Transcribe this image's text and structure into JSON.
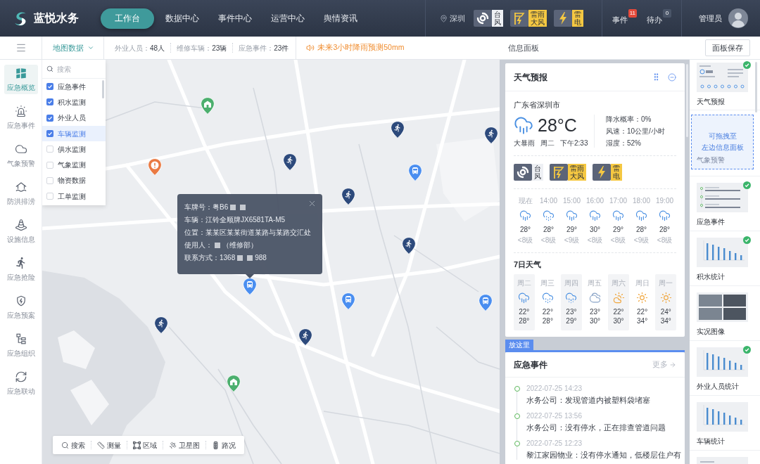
{
  "header": {
    "brand": "蓝悦水务",
    "nav": [
      {
        "label": "工作台",
        "selected": true
      },
      {
        "label": "数据中心",
        "selected": false
      },
      {
        "label": "事件中心",
        "selected": false
      },
      {
        "label": "运营中心",
        "selected": false
      },
      {
        "label": "舆情资讯",
        "selected": false
      }
    ],
    "location": "深圳",
    "warnings": [
      {
        "kind": "typhoon",
        "label": "台风",
        "color": "#eef0f4"
      },
      {
        "kind": "thunderstorm_wind",
        "label": "雷雨大风",
        "color": "#f5c842"
      },
      {
        "kind": "lightning",
        "label": "雷电",
        "color": "#f5c842"
      }
    ],
    "notifications": [
      {
        "label": "事件",
        "count": "11",
        "color": "#e5493a"
      },
      {
        "label": "待办",
        "count": "0",
        "color": "#4a5568"
      }
    ],
    "user": "管理员"
  },
  "toolbar": {
    "layer_menu": "地图数据",
    "stats": [
      {
        "label": "外业人员：",
        "value": "48人"
      },
      {
        "label": "维修车辆：",
        "value": "23辆"
      },
      {
        "label": "应急事件：",
        "value": "23件"
      }
    ],
    "alert": "未来3小时降雨预测50mm",
    "panel_title": "信息面板",
    "save_button": "面板保存"
  },
  "sidebar": [
    {
      "label": "应急概览",
      "selected": true
    },
    {
      "label": "应急事件",
      "selected": false
    },
    {
      "label": "气象预警",
      "selected": false
    },
    {
      "label": "防洪排涝",
      "selected": false
    },
    {
      "label": "设施信息",
      "selected": false
    },
    {
      "label": "应急抢险",
      "selected": false
    },
    {
      "label": "应急预案",
      "selected": false
    },
    {
      "label": "应急组织",
      "selected": false
    },
    {
      "label": "应急联动",
      "selected": false
    }
  ],
  "layer_menu": {
    "search_placeholder": "搜索",
    "items": [
      {
        "label": "应急事件",
        "checked": true,
        "selected": false
      },
      {
        "label": "积水监测",
        "checked": true,
        "selected": false
      },
      {
        "label": "外业人员",
        "checked": true,
        "selected": false
      },
      {
        "label": "车辆监测",
        "checked": true,
        "selected": true
      },
      {
        "label": "供水监测",
        "checked": false,
        "selected": false
      },
      {
        "label": "气象监测",
        "checked": false,
        "selected": false
      },
      {
        "label": "物资数据",
        "checked": false,
        "selected": false
      },
      {
        "label": "工单监测",
        "checked": false,
        "selected": false
      }
    ]
  },
  "map": {
    "markers": [
      {
        "kind": "water"
      },
      {
        "kind": "emergency"
      },
      {
        "kind": "person"
      },
      {
        "kind": "person"
      },
      {
        "kind": "person"
      },
      {
        "kind": "vehicle"
      },
      {
        "kind": "person"
      },
      {
        "kind": "person"
      },
      {
        "kind": "vehicle"
      },
      {
        "kind": "vehicle"
      },
      {
        "kind": "vehicle"
      },
      {
        "kind": "person"
      },
      {
        "kind": "person"
      },
      {
        "kind": "water"
      }
    ],
    "popup": {
      "rows": [
        [
          {
            "kind": "text",
            "text": "车牌号：粤B6"
          },
          {
            "kind": "mask"
          },
          {
            "kind": "mask"
          }
        ],
        [
          {
            "kind": "text",
            "text": "车辆：江铃全顺牌JX6581TA-M5"
          }
        ],
        [
          {
            "kind": "text",
            "text": "位置：某某区某某街道某路与某路交汇处"
          }
        ],
        [
          {
            "kind": "text",
            "text": "使用人："
          },
          {
            "kind": "mask"
          },
          {
            "kind": "text",
            "text": "（维修部）"
          }
        ],
        [
          {
            "kind": "text",
            "text": "联系方式：1368"
          },
          {
            "kind": "mask"
          },
          {
            "kind": "mask"
          },
          {
            "kind": "text",
            "text": "988"
          }
        ]
      ]
    },
    "tools": [
      "搜索",
      "测量",
      "区域",
      "卫星图",
      "路况"
    ]
  },
  "weather": {
    "title": "天气预报",
    "region": "广东省深圳市",
    "kind": "rain",
    "temperature": "28°C",
    "condition": "大暴雨",
    "weekday": "周二",
    "time": "下午2:33",
    "details": [
      "降水概率：0%",
      "风速：10公里/小时",
      "湿度：52%"
    ],
    "warnings": [
      {
        "kind": "typhoon",
        "label": "台风",
        "color": "#eef0f4"
      },
      {
        "kind": "thunderstorm_wind",
        "label": "雷雨大风",
        "color": "#f5c842"
      },
      {
        "kind": "lightning",
        "label": "雷电",
        "color": "#f5c842"
      }
    ],
    "hourly": [
      {
        "time": "现在",
        "kind": "rain",
        "temp": "28°",
        "wind": "<8级"
      },
      {
        "time": "14:00",
        "kind": "showers",
        "temp": "28°",
        "wind": "<8级"
      },
      {
        "time": "15:00",
        "kind": "rain",
        "temp": "29°",
        "wind": "<9级"
      },
      {
        "time": "16:00",
        "kind": "rain",
        "temp": "30°",
        "wind": "<8级"
      },
      {
        "time": "17:00",
        "kind": "rain",
        "temp": "29°",
        "wind": "<8级"
      },
      {
        "time": "18:00",
        "kind": "rain",
        "temp": "28°",
        "wind": "<9级"
      },
      {
        "time": "19:00",
        "kind": "rain",
        "temp": "28°",
        "wind": "<8级"
      }
    ],
    "daily_title": "7日天气",
    "daily": [
      {
        "day": "周二",
        "kind": "rain",
        "low": "22°",
        "high": "28°"
      },
      {
        "day": "周三",
        "kind": "showers",
        "low": "22°",
        "high": "28°"
      },
      {
        "day": "周四",
        "kind": "drizzle",
        "low": "23°",
        "high": "29°"
      },
      {
        "day": "周五",
        "kind": "cloudy",
        "low": "23°",
        "high": "30°"
      },
      {
        "day": "周六",
        "kind": "partly_cloudy",
        "low": "22°",
        "high": "30°"
      },
      {
        "day": "周日",
        "kind": "sunny",
        "low": "22°",
        "high": "34°"
      },
      {
        "day": "周一",
        "kind": "sunny",
        "low": "24°",
        "high": "34°"
      }
    ]
  },
  "drop_hint": "放这里",
  "events": {
    "title": "应急事件",
    "more": "更多",
    "items": [
      {
        "time": "2022-07-25 14:23",
        "text": "水务公司：发现管道内被塑料袋堵塞"
      },
      {
        "time": "2022-07-25 13:56",
        "text": "水务公司：没有停水，正在排查管道问题"
      },
      {
        "time": "2022-07-25 12:23",
        "text": "黎江家园物业：没有停水通知，低楼层住户有"
      }
    ]
  },
  "widgets": [
    {
      "kind": "weather",
      "label": "天气预报",
      "added": true
    },
    {
      "kind": "drop_target",
      "label": "气象预警",
      "hint": [
        "可拖拽至",
        "左边信息面板"
      ]
    },
    {
      "kind": "timeline",
      "label": "应急事件",
      "added": true
    },
    {
      "kind": "bar_chart",
      "label": "积水统计",
      "added": true
    },
    {
      "kind": "photos",
      "label": "实况图像",
      "added": false
    },
    {
      "kind": "bar_chart",
      "label": "外业人员统计",
      "added": true
    },
    {
      "kind": "bar_chart",
      "label": "车辆统计",
      "added": false
    },
    {
      "kind": "document",
      "added": false
    }
  ]
}
